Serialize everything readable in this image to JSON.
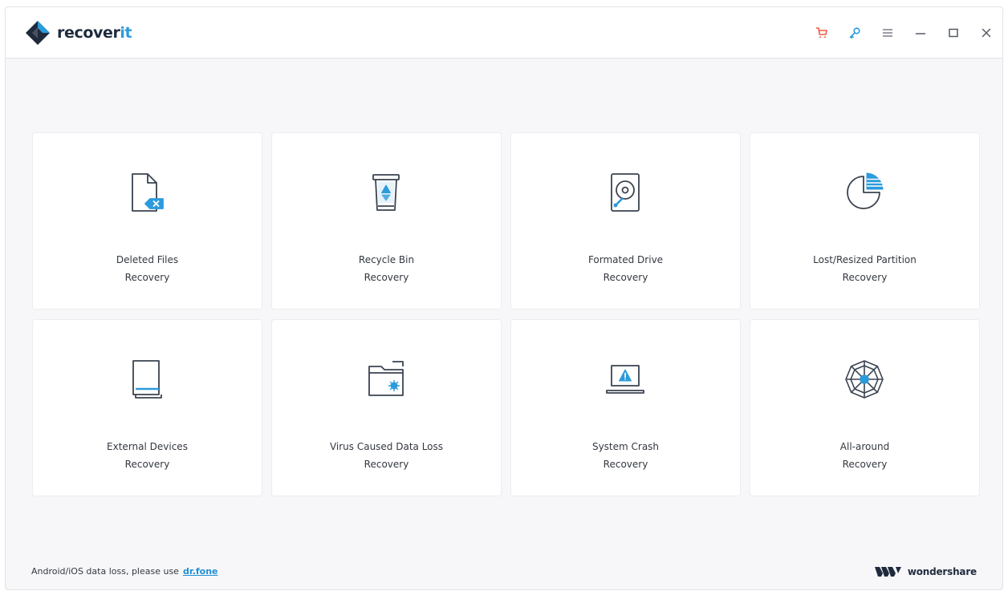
{
  "app": {
    "brand_main": "recover",
    "brand_accent": "it"
  },
  "colors": {
    "brand_navy": "#1f2b3d",
    "brand_blue": "#2c9bdb",
    "cart_red": "#ef5a40",
    "link_blue": "#1f8fd6",
    "window_bg": "#f7f7f9"
  },
  "toolbar": {
    "cart_icon": "shopping-cart-icon",
    "key_icon": "key-icon",
    "menu_icon": "menu-icon",
    "minimize_icon": "minimize-icon",
    "maximize_icon": "maximize-icon",
    "close_icon": "close-icon"
  },
  "cards": [
    {
      "icon": "deleted-file-icon",
      "line1": "Deleted Files",
      "line2": "Recovery"
    },
    {
      "icon": "recycle-bin-icon",
      "line1": "Recycle Bin",
      "line2": "Recovery"
    },
    {
      "icon": "hard-drive-icon",
      "line1": "Formated Drive",
      "line2": "Recovery"
    },
    {
      "icon": "partition-pie-icon",
      "line1": "Lost/Resized Partition",
      "line2": "Recovery"
    },
    {
      "icon": "external-device-icon",
      "line1": "External Devices",
      "line2": "Recovery"
    },
    {
      "icon": "virus-folder-icon",
      "line1": "Virus Caused Data Loss",
      "line2": "Recovery"
    },
    {
      "icon": "system-crash-laptop-icon",
      "line1": "System Crash",
      "line2": "Recovery"
    },
    {
      "icon": "all-around-wheel-icon",
      "line1": "All-around",
      "line2": "Recovery"
    }
  ],
  "footer": {
    "note_text": "Android/iOS data loss, please use",
    "link_text": "dr.fone",
    "company": "wondershare"
  }
}
